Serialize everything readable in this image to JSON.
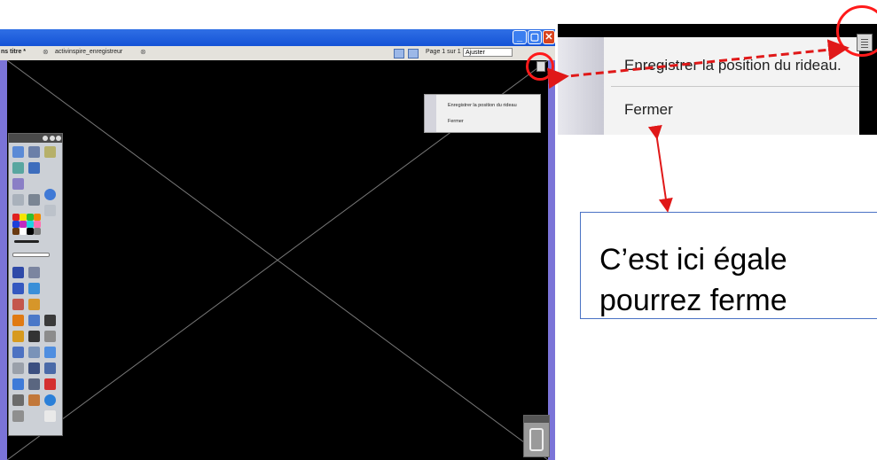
{
  "window": {
    "tab_title": "ns titre *",
    "tab_close": "⊗",
    "second_tab": "activinspire_enregistreur",
    "second_tab_close": "⊗",
    "minimize_glyph": "_",
    "maximize_glyph": "▢",
    "close_glyph": "✕",
    "page_indicator": "Page 1 sur 1",
    "zoom_value": "Ajuster"
  },
  "curtain_menu": {
    "items": [
      {
        "label": "Enregistrer la position du rideau."
      },
      {
        "label": "Fermer"
      }
    ],
    "small_items": [
      {
        "label": "Enregistrer la position du rideau"
      },
      {
        "label": "Fermer"
      }
    ]
  },
  "callout": {
    "line1": "C’est ici égale",
    "line2": "pourrez ferme"
  },
  "colors": {
    "annotation_red": "#ff1a1a",
    "callout_border": "#4a72c4",
    "titlebar_blue": "#1553d6",
    "board_border": "#7b74d8"
  },
  "icons": [
    "menu-icon",
    "trash-icon",
    "toolbox-icons"
  ]
}
